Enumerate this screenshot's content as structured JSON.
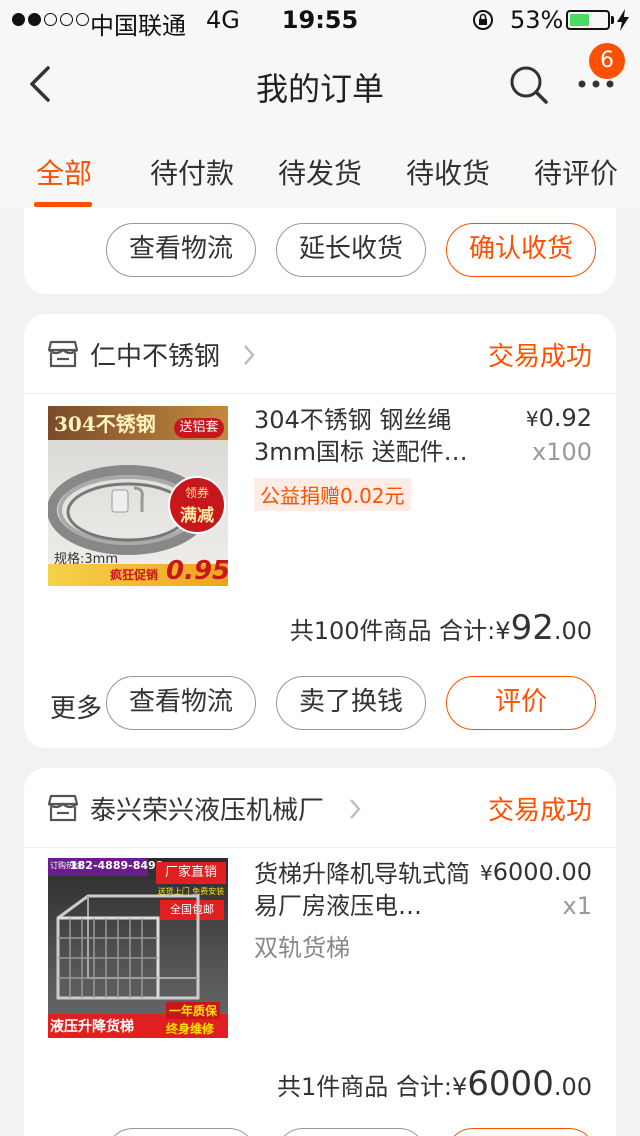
{
  "status_bar": {
    "carrier": "中国联通",
    "network": "4G",
    "time": "19:55",
    "battery": "53%",
    "battery_level": 0.53
  },
  "nav": {
    "title": "我的订单",
    "badge": "6"
  },
  "tabs": [
    {
      "label": "全部"
    },
    {
      "label": "待付款"
    },
    {
      "label": "待发货"
    },
    {
      "label": "待收货"
    },
    {
      "label": "待评价"
    }
  ],
  "colors": {
    "accent": "#ff5000",
    "success": "#4cd964"
  },
  "top_card": {
    "buttons": [
      "查看物流",
      "延长收货",
      "确认收货"
    ]
  },
  "orders": [
    {
      "shop": "仁中不锈钢",
      "status": "交易成功",
      "thumb": {
        "banner": "304不锈钢",
        "tag": "送铝套",
        "coupon_top": "领券",
        "coupon_bottom": "满减",
        "spec": "规格:3mm",
        "promo": "疯狂促销",
        "price": "0.95"
      },
      "title": "304不锈钢 钢丝绳 3mm国标 送配件…",
      "donation": "公益捐赠0.02元",
      "price_symbol": "¥",
      "price": "0.92",
      "qty": "x100",
      "summary_label": "共100件商品 合计:",
      "total_symbol": "¥",
      "total_int": "92",
      "total_dec": ".00",
      "more": "更多",
      "buttons": [
        "查看物流",
        "卖了换钱",
        "评价"
      ]
    },
    {
      "shop": "泰兴荣兴液压机械厂",
      "status": "交易成功",
      "thumb": {
        "phone_label": "订购热线",
        "phone": "182-4889-8490",
        "ribbon1": "厂家直销",
        "ribbon2": "送货上门 免费安装",
        "ribbon3": "全国包邮",
        "bottom_left": "液压升降货梯",
        "bottom_right1": "一年质保",
        "bottom_right2": "终身维修"
      },
      "title": "货梯升降机导轨式简易厂房液压电…",
      "sub": "双轨货梯",
      "price_symbol": "¥",
      "price": "6000.00",
      "qty": "x1",
      "summary_label": "共1件商品 合计:",
      "total_symbol": "¥",
      "total_int": "6000",
      "total_dec": ".00"
    }
  ]
}
